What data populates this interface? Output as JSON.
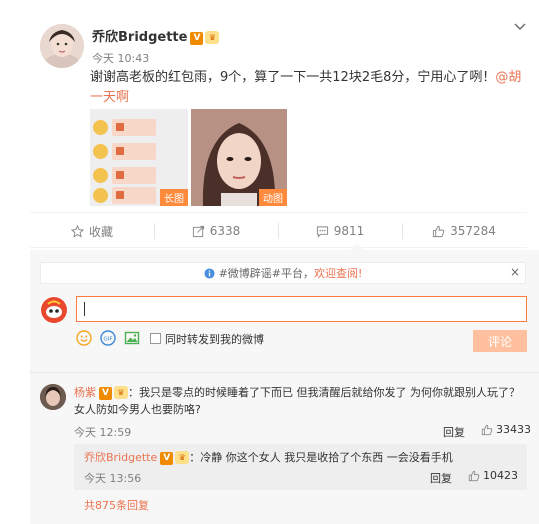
{
  "post": {
    "username": "乔欣Bridgette",
    "verified_badge": "V",
    "timestamp": "今天 10:43",
    "text_before_mention": "谢谢高老板的红包雨，9个，算了一下一共12块2毛8分，宁用心了咧！",
    "mention": "@胡一天啊",
    "image_long_tag": "长图",
    "image_gif_tag": "动图"
  },
  "actions": {
    "favorite_label": "收藏",
    "repost_count": "6338",
    "comment_count": "9811",
    "like_count": "357284"
  },
  "composer": {
    "notice_prefix": "#微博辟谣#平台，",
    "notice_link": "欢迎查阅!",
    "notice_close": "×",
    "repost_label": "同时转发到我的微博",
    "submit_label": "评论"
  },
  "comments": [
    {
      "name": "杨紫",
      "text": "：我只是零点的时候睡着了下而已 但我清醒后就给你发了 为何你就跟别人玩了？女人防如今男人也要防咯?",
      "time": "今天 12:59",
      "reply_label": "回复",
      "likes": "33433"
    },
    {
      "name": "乔欣Bridgette",
      "text": "：冷静 你这个女人 我只是收拾了个东西 一会没看手机",
      "time": "今天 13:56",
      "reply_label": "回复",
      "likes": "10423"
    }
  ],
  "more_replies": "共875条回复",
  "colors": {
    "accent": "#eb7350",
    "input_border": "#fa7d3c",
    "submit_disabled": "#ffc09f",
    "verified": "#f08a00"
  }
}
